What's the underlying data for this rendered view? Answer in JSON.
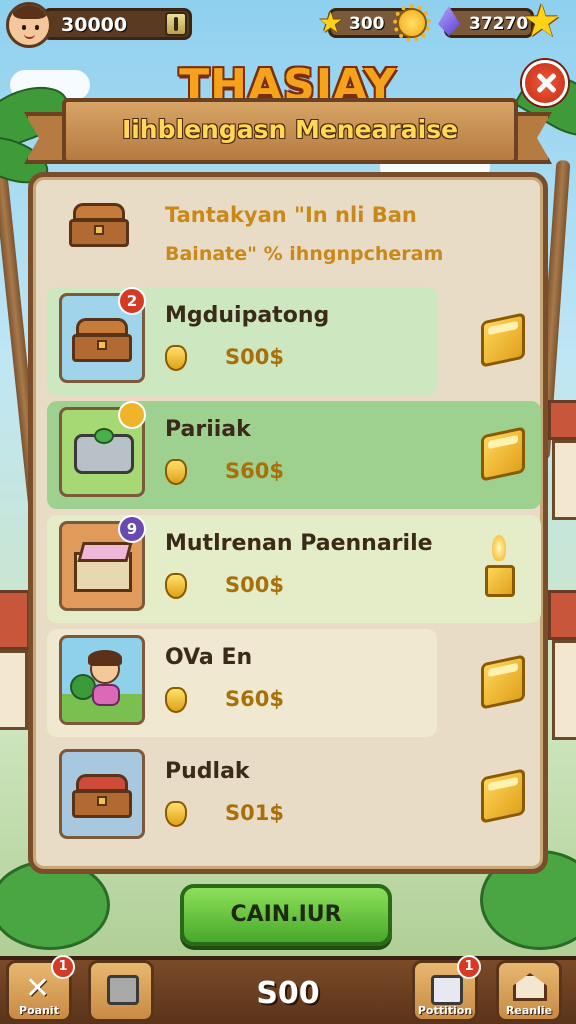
{
  "hud": {
    "coins": "30000",
    "stars": "300",
    "gems": "37270"
  },
  "title": "THASIAY",
  "banner": "Iihblengasn Menearaise",
  "intro": {
    "line1": "Tantakyan \"In nli Ban",
    "line2": "Bainate\" % ihngnpcheram"
  },
  "items": [
    {
      "name": "Mgduipatong",
      "price": "S00$",
      "badge": "2",
      "art": "chest-icon"
    },
    {
      "name": "Pariiak",
      "price": "S60$",
      "badge": "",
      "art": "cooking-pot-icon"
    },
    {
      "name": "Mutlrenan Paennarile",
      "price": "S00$",
      "badge": "9",
      "art": "gift-box-icon"
    },
    {
      "name": "OVa En",
      "price": "S60$",
      "badge": "",
      "art": "child-icon"
    },
    {
      "name": "Pudlak",
      "price": "S01$",
      "badge": "",
      "art": "chest-icon"
    }
  ],
  "continue_button": "CAIN.IUR",
  "bottom": {
    "total": "S00",
    "left_label": "Poanit",
    "left_badge": "1",
    "right1_label": "Pottition",
    "right1_badge": "1",
    "right2_label": "Reanlie"
  },
  "colors": {
    "accent_gold": "#f7a21b",
    "panel": "#e9dcc6",
    "wood": "#7a4e2a",
    "green": "#48a82a"
  }
}
